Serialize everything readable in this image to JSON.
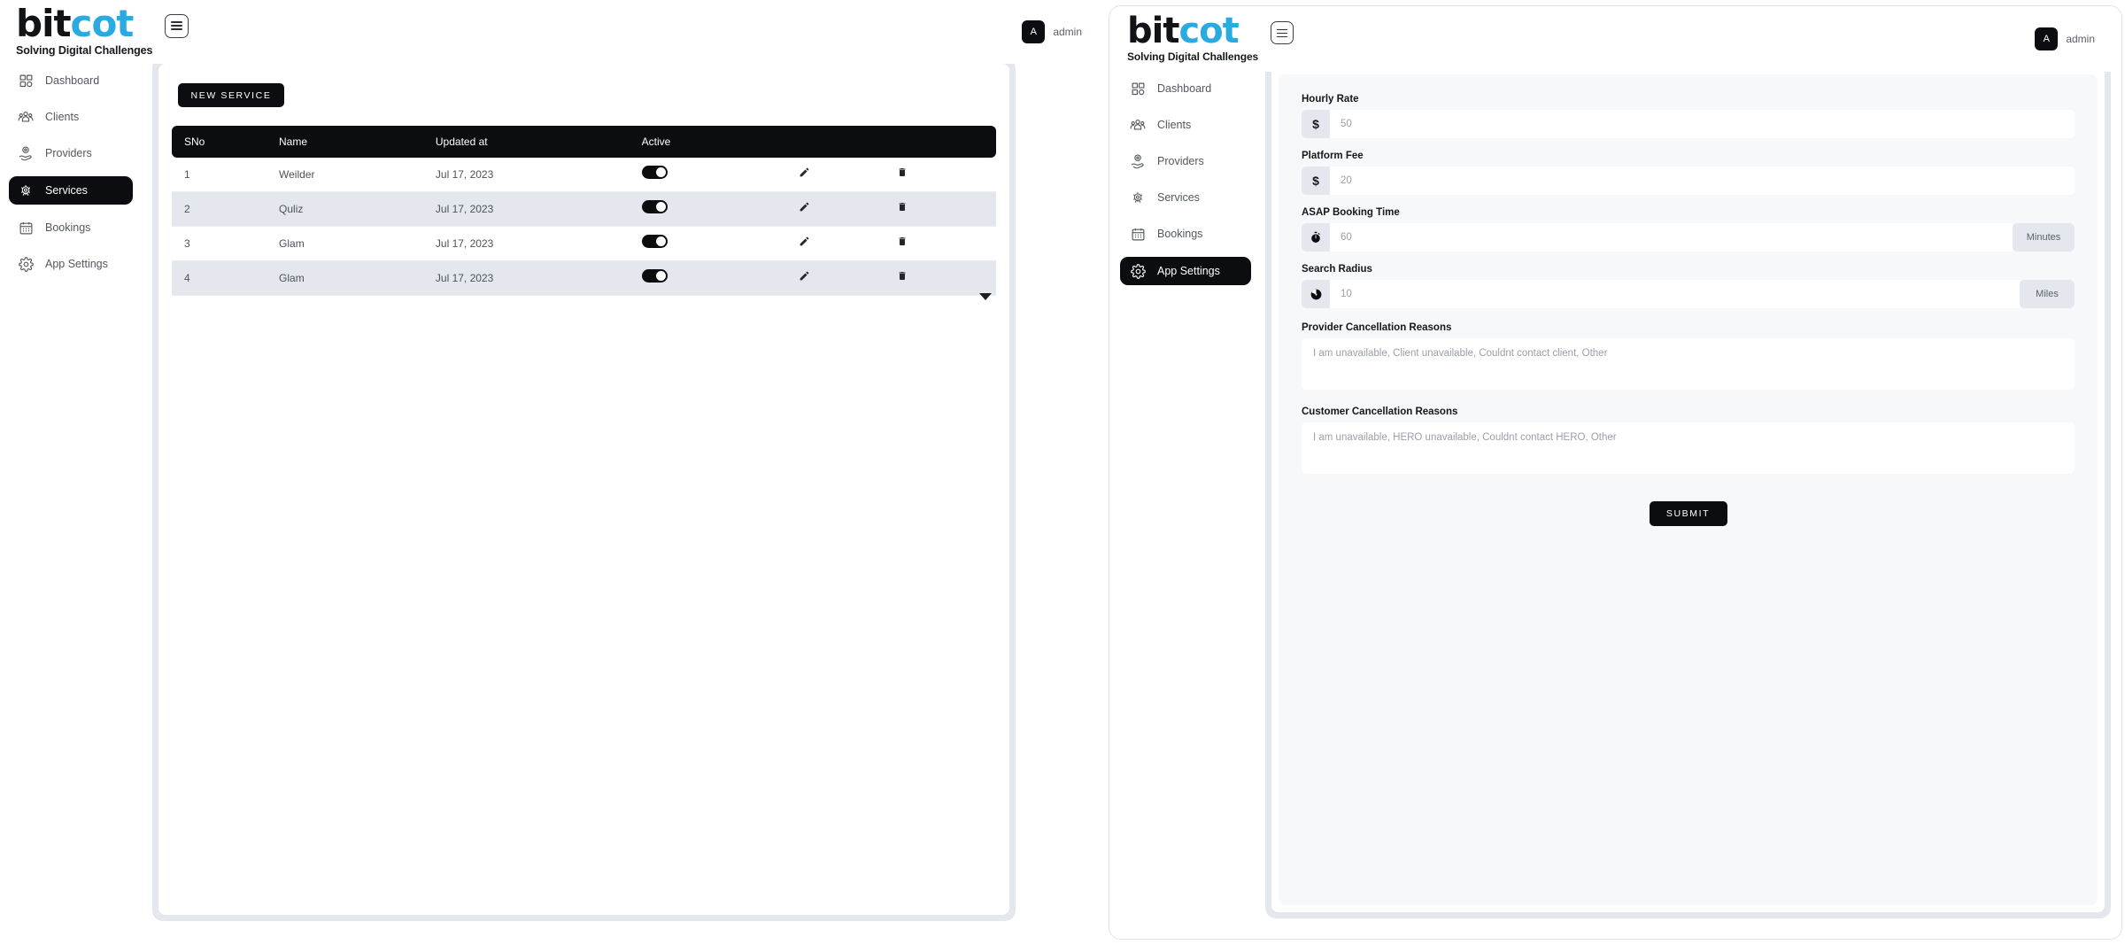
{
  "brand": {
    "name_part1": "bit",
    "name_part2": "cot",
    "tagline": "Solving Digital Challenges",
    "accent_color": "#29abe2",
    "dark_color": "#111317"
  },
  "header": {
    "avatar_initial": "A",
    "username": "admin",
    "menu_icon": "hamburger-icon"
  },
  "sidebar": {
    "items": [
      {
        "label": "Dashboard",
        "icon": "dashboard-grid-icon",
        "active_left": false,
        "active_right": false
      },
      {
        "label": "Clients",
        "icon": "people-group-icon",
        "active_left": false,
        "active_right": false
      },
      {
        "label": "Providers",
        "icon": "provider-hand-icon",
        "active_left": false,
        "active_right": false
      },
      {
        "label": "Services",
        "icon": "services-gear-people-icon",
        "active_left": true,
        "active_right": false
      },
      {
        "label": "Bookings",
        "icon": "calendar-icon",
        "active_left": false,
        "active_right": false
      },
      {
        "label": "App Settings",
        "icon": "gear-icon",
        "active_left": false,
        "active_right": true
      }
    ]
  },
  "services_page": {
    "new_button_label": "NEW SERVICE",
    "table": {
      "columns": [
        "SNo",
        "Name",
        "Updated at",
        "Active",
        "",
        ""
      ],
      "rows": [
        {
          "sno": "1",
          "name": "Weilder",
          "updated_at": "Jul 17, 2023",
          "active": true,
          "edit_icon": "pencil-icon",
          "delete_icon": "trash-icon"
        },
        {
          "sno": "2",
          "name": "Quliz",
          "updated_at": "Jul 17, 2023",
          "active": true,
          "edit_icon": "pencil-icon",
          "delete_icon": "trash-icon"
        },
        {
          "sno": "3",
          "name": "Glam",
          "updated_at": "Jul 17, 2023",
          "active": true,
          "edit_icon": "pencil-icon",
          "delete_icon": "trash-icon"
        },
        {
          "sno": "4",
          "name": "Glam",
          "updated_at": "Jul 17, 2023",
          "active": true,
          "edit_icon": "pencil-icon",
          "delete_icon": "trash-icon"
        }
      ]
    },
    "scroll_caret_icon": "chevron-down-icon"
  },
  "app_settings_page": {
    "fields": [
      {
        "label": "Hourly Rate",
        "addon": "$",
        "addon_icon": "dollar-icon",
        "value": "50",
        "suffix": ""
      },
      {
        "label": "Platform Fee",
        "addon": "$",
        "addon_icon": "dollar-icon",
        "value": "20",
        "suffix": ""
      },
      {
        "label": "ASAP Booking Time",
        "addon": "",
        "addon_icon": "stopwatch-icon",
        "value": "60",
        "suffix": "Minutes"
      },
      {
        "label": "Search Radius",
        "addon": "",
        "addon_icon": "radar-icon",
        "value": "10",
        "suffix": "Miles"
      }
    ],
    "textareas": [
      {
        "label": "Provider Cancellation Reasons",
        "value": "I am unavailable, Client unavailable, Couldnt contact client, Other"
      },
      {
        "label": "Customer Cancellation Reasons",
        "value": "I am unavailable, HERO unavailable, Couldnt contact HERO, Other"
      }
    ],
    "submit_label": "SUBMIT"
  }
}
